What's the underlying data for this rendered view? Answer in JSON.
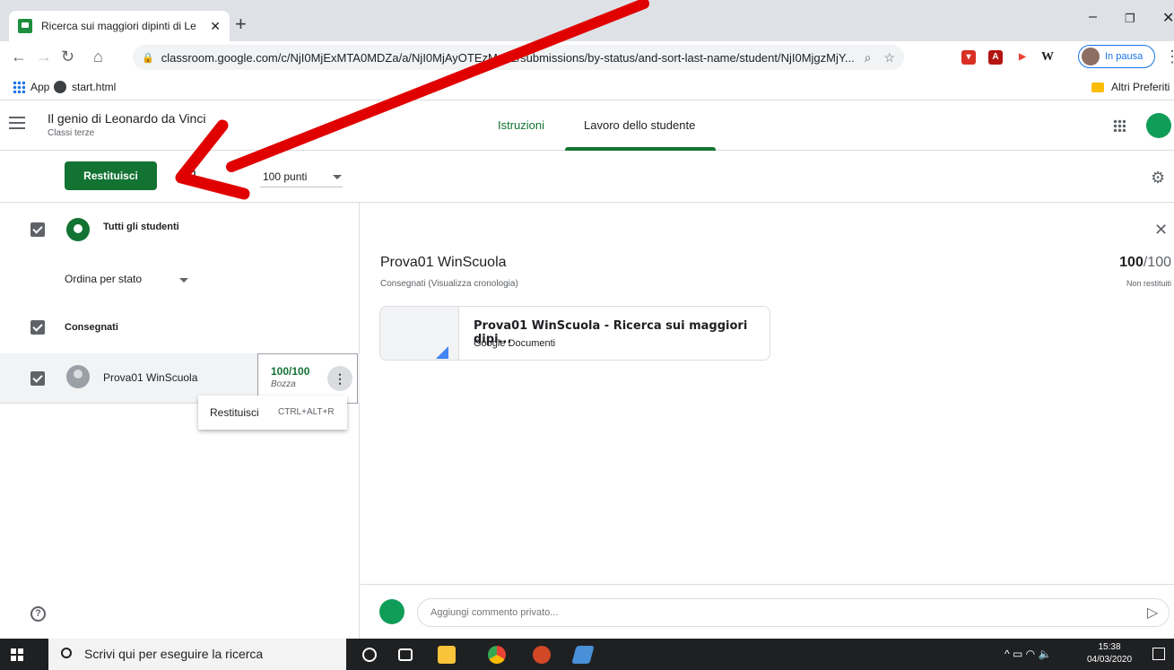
{
  "browser": {
    "tab_title": "Ricerca sui maggiori dipinti di Le",
    "url": "classroom.google.com/c/NjI0MjExMTA0MDZa/a/NjI0MjAyOTEzMzAz/submissions/by-status/and-sort-last-name/student/NjI0MjgzMjY...",
    "profile_label": "In pausa"
  },
  "bookmarks": {
    "apps": "App",
    "start": "start.html",
    "others": "Altri Preferiti"
  },
  "classroom": {
    "class_name": "Il genio di Leonardo da Vinci",
    "section": "Classi terze",
    "tabs": [
      "Istruzioni",
      "Lavoro dello studente"
    ],
    "return_button": "Restituisci",
    "points": "100 punti"
  },
  "left_pane": {
    "all_students": "Tutti gli studenti",
    "sort_label": "Ordina per stato",
    "group_label": "Consegnati",
    "student_name": "Prova01 WinScuola",
    "grade": "100/100",
    "grade_state": "Bozza",
    "menu_item": "Restituisci",
    "menu_shortcut": "CTRL+ALT+R"
  },
  "right_pane": {
    "student_name": "Prova01 WinScuola",
    "status": "Consegnati (Visualizza cronologia)",
    "grade_num": "100",
    "grade_den": "/100",
    "grade_state": "Non restituiti",
    "attachment_title": "Prova01 WinScuola - Ricerca sui maggiori dipi...",
    "attachment_type": "Google Documenti",
    "comment_placeholder": "Aggiungi commento privato..."
  },
  "taskbar": {
    "search_placeholder": "Scrivi qui per eseguire la ricerca",
    "time": "15:38",
    "date": "04/03/2020"
  },
  "colors": {
    "accent": "#137333",
    "annotation_arrow": "#e00000"
  }
}
